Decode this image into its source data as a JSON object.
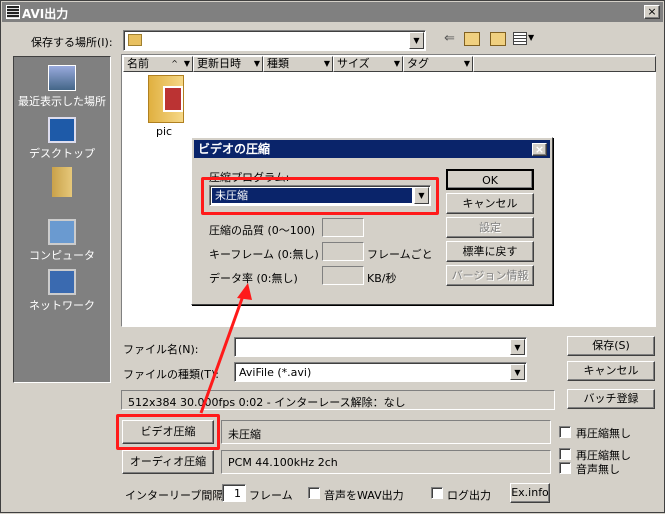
{
  "window": {
    "title": "AVI出力",
    "close_label": "×"
  },
  "location": {
    "label": "保存する場所(I):",
    "value": ""
  },
  "places": [
    {
      "label": "最近表示した場所"
    },
    {
      "label": "デスクトップ"
    },
    {
      "label": ""
    },
    {
      "label": "コンピュータ"
    },
    {
      "label": "ネットワーク"
    }
  ],
  "columns": [
    "名前",
    "更新日時",
    "種類",
    "サイズ",
    "タグ"
  ],
  "files": [
    {
      "name": "pic"
    }
  ],
  "filename": {
    "label": "ファイル名(N):",
    "value": ""
  },
  "filetype": {
    "label": "ファイルの種類(T):",
    "value": "AviFile (*.avi)"
  },
  "buttons": {
    "save": "保存(S)",
    "cancel": "キャンセル",
    "batch": "バッチ登録",
    "video_compress": "ビデオ圧縮",
    "audio_compress": "オーディオ圧縮",
    "exinfo": "Ex.info"
  },
  "info_line": "512x384  30.000fps  0:02  -  インターレース解除：なし",
  "video_codec": "未圧縮",
  "audio_codec": "PCM 44.100kHz 2ch",
  "checkboxes": {
    "no_compress_video": "再圧縮無し",
    "no_compress_audio": "再圧縮無し",
    "no_audio": "音声無し",
    "wav_out": "音声をWAV出力",
    "log_out": "ログ出力"
  },
  "interleave": {
    "label": "インターリーブ間隔：",
    "value": "1",
    "unit": "フレーム"
  },
  "dialog": {
    "title": "ビデオの圧縮",
    "close_label": "×",
    "program_label": "圧縮プログラム:",
    "program_value": "未圧縮",
    "quality_label": "圧縮の品質 (0〜100)",
    "keyframe_label": "キーフレーム (0:無し)",
    "keyframe_unit": "フレームごと",
    "datarate_label": "データ率 (0:無し)",
    "datarate_unit": "KB/秒",
    "ok": "OK",
    "cancel": "キャンセル",
    "settings": "設定",
    "defaults": "標準に戻す",
    "version": "バージョン情報"
  },
  "colors": {
    "highlight": "#0a246a",
    "annotation": "#ff1a1a"
  }
}
